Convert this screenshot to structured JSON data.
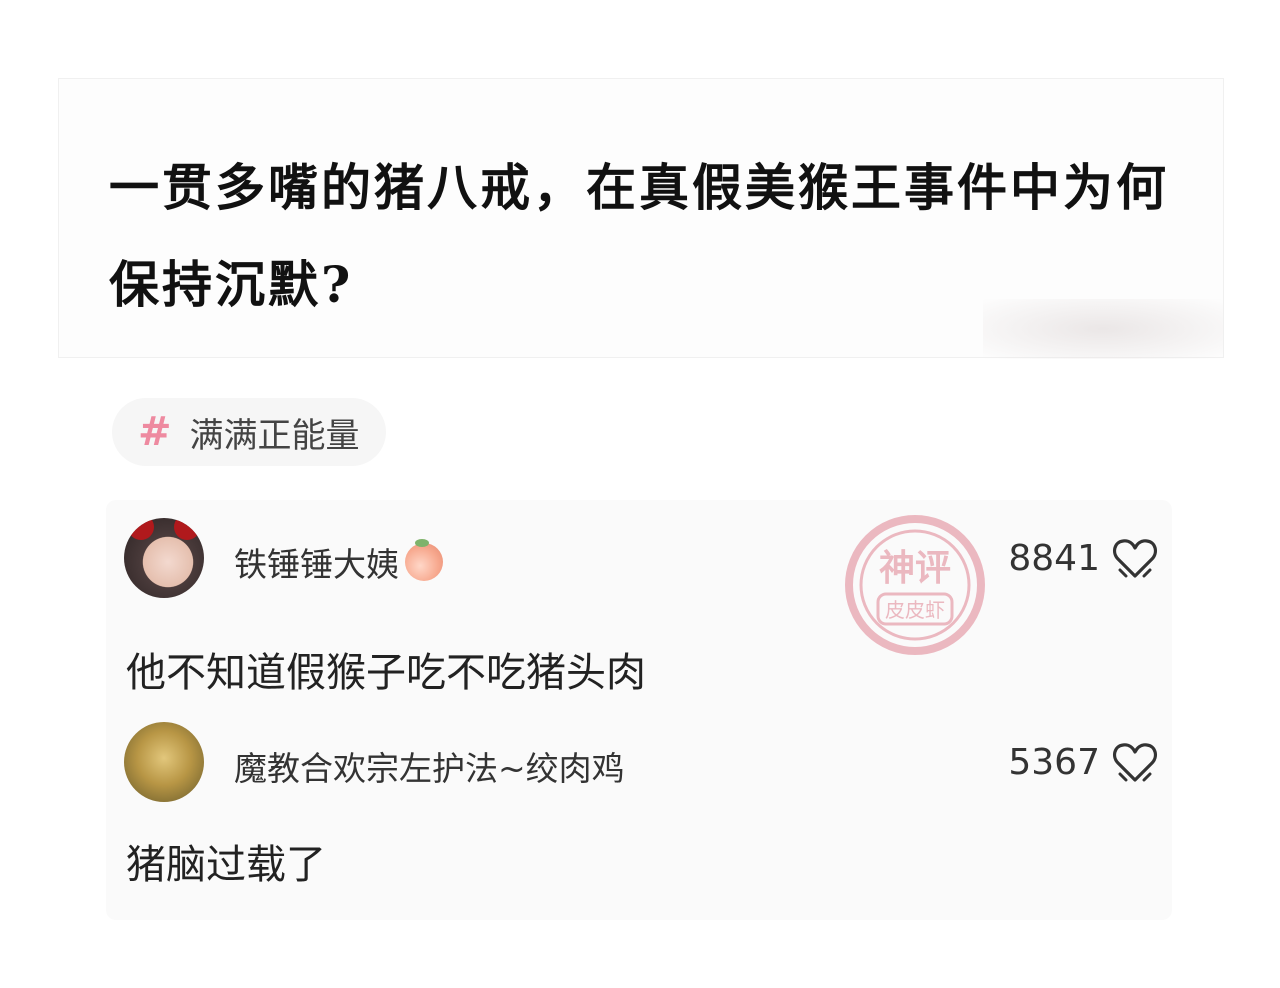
{
  "question": {
    "title": "一贯多嘴的猪八戒，在真假美猴王事件中为何保持沉默?"
  },
  "tag": {
    "icon": "hash-icon",
    "symbol": "#",
    "label": "满满正能量"
  },
  "watermark": {
    "text_top": "神评",
    "text_bottom": "皮皮虾"
  },
  "comments": [
    {
      "username": "铁锤锤大姨",
      "badge_icon": "peach-icon",
      "likes": "8841",
      "text": "他不知道假猴子吃不吃猪头肉"
    },
    {
      "username": "魔教合欢宗左护法~绞肉鸡",
      "likes": "5367",
      "text": "猪脑过载了"
    }
  ],
  "colors": {
    "tag_hash": "#ee8aa0",
    "panel_bg": "#fafafa",
    "stamp": "#c8102e"
  }
}
